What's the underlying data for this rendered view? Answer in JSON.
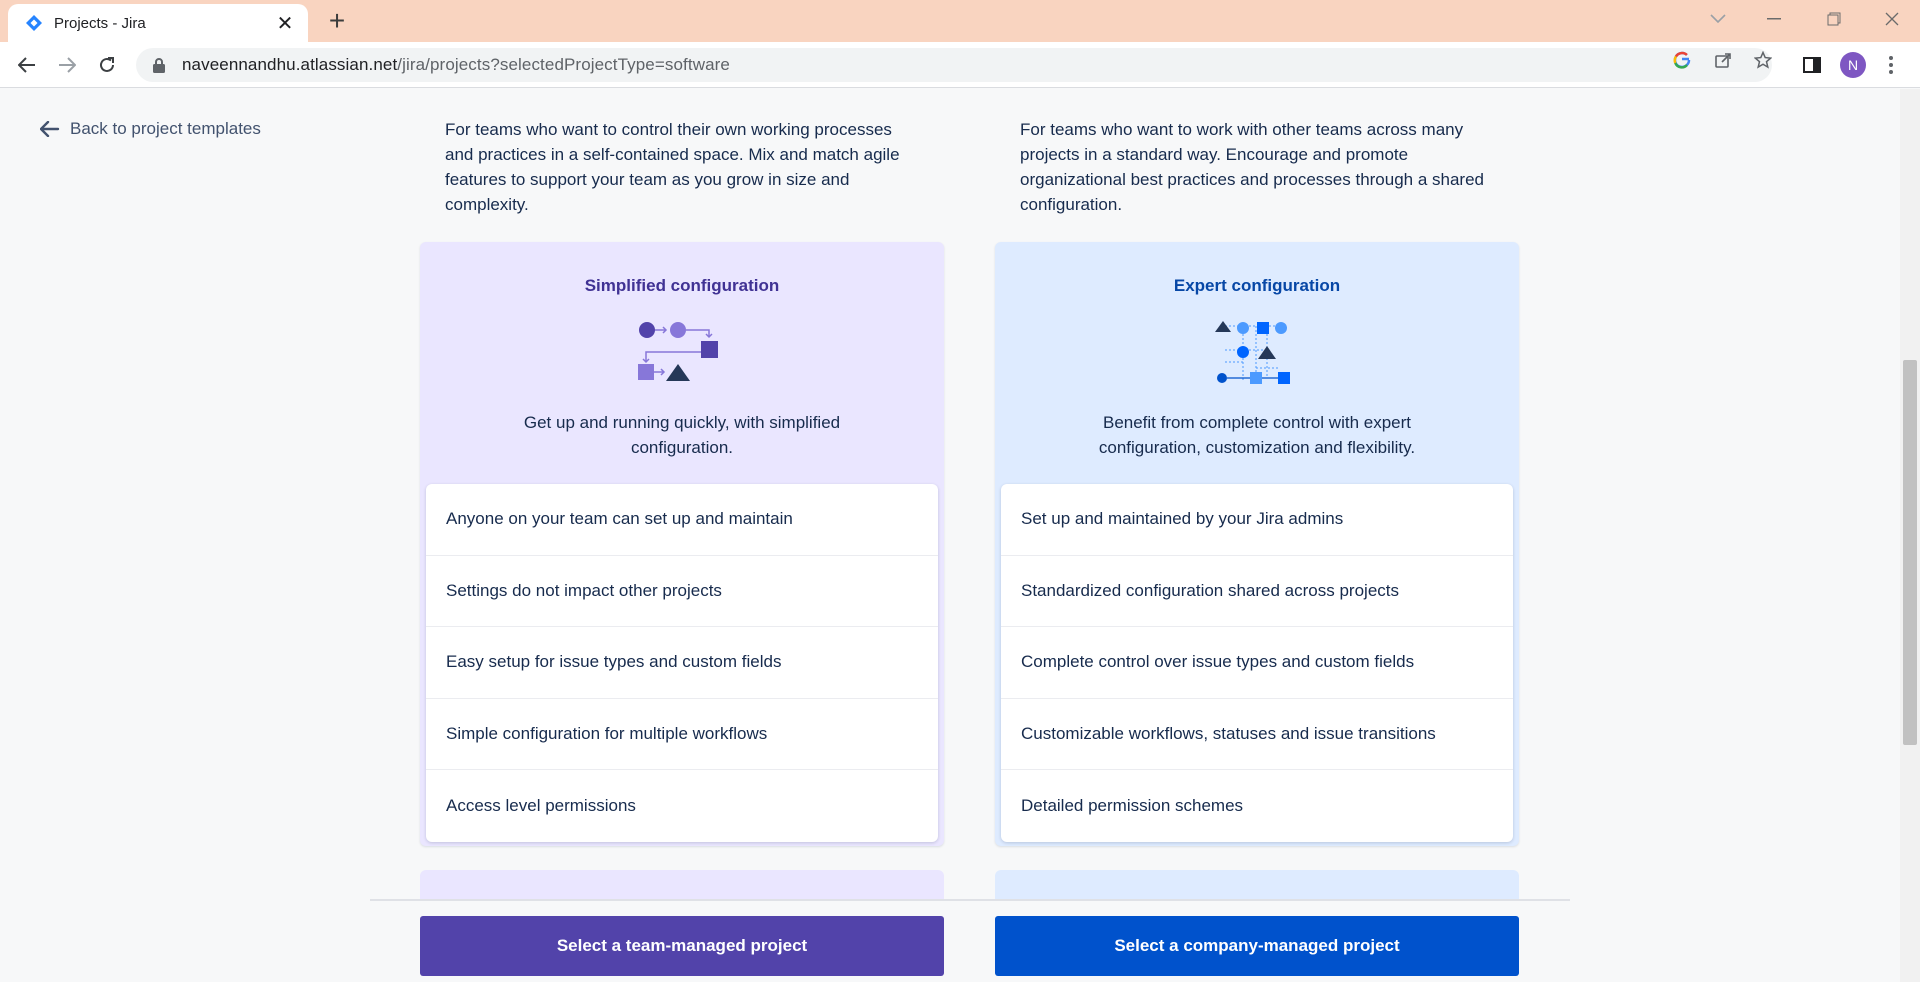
{
  "browser": {
    "tab_title": "Projects - Jira",
    "new_tab": "+",
    "url_host": "naveennandhu.atlassian.net",
    "url_path": "/jira/projects?selectedProjectType=software",
    "avatar_letter": "N"
  },
  "back_link": {
    "label": "Back to project templates"
  },
  "team_managed": {
    "description": "For teams who want to control their own working processes and practices in a self-contained space. Mix and match agile features to support your team as you grow in size and complexity.",
    "card_title": "Simplified configuration",
    "card_subtitle": "Get up and running quickly, with simplified configuration.",
    "features": [
      "Anyone on your team can set up and maintain",
      "Settings do not impact other projects",
      "Easy setup for issue types and custom fields",
      "Simple configuration for multiple workflows",
      "Access level permissions"
    ],
    "cta": "Select a team-managed project",
    "accent": "#5243aa"
  },
  "company_managed": {
    "description": "For teams who want to work with other teams across many projects in a standard way. Encourage and promote organizational best practices and processes through a shared configuration.",
    "card_title": "Expert configuration",
    "card_subtitle": "Benefit from complete control with expert configuration, customization and flexibility.",
    "features": [
      "Set up and maintained by your Jira admins",
      "Standardized configuration shared across projects",
      "Complete control over issue types and custom fields",
      "Customizable workflows, statuses and issue transitions",
      "Detailed permission schemes"
    ],
    "cta": "Select a company-managed project",
    "accent": "#0052cc"
  }
}
